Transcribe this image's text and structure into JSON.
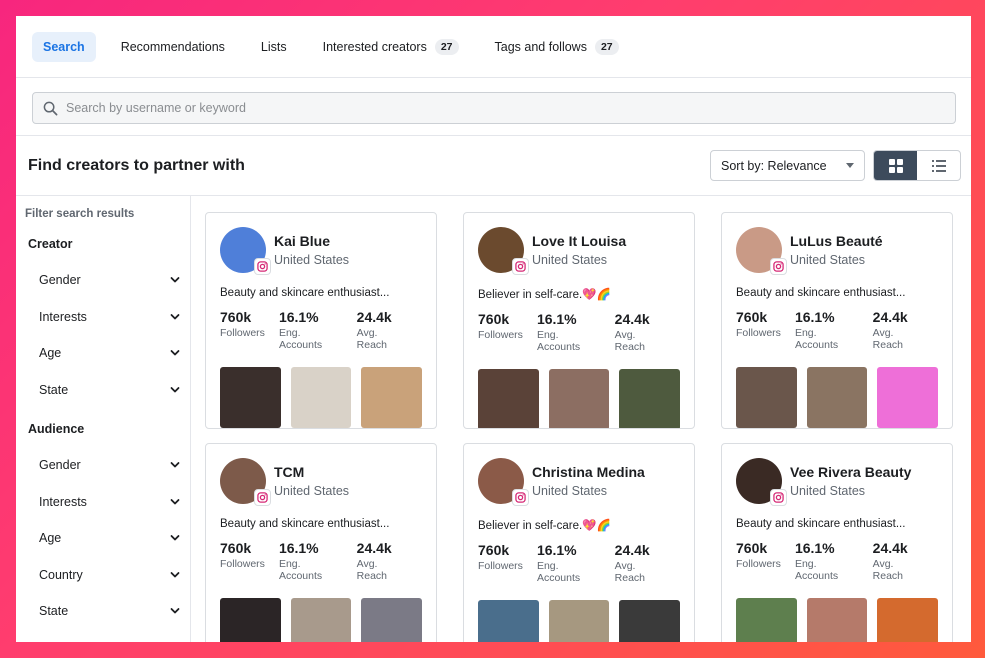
{
  "tabs": [
    {
      "label": "Search",
      "active": true
    },
    {
      "label": "Recommendations"
    },
    {
      "label": "Lists"
    },
    {
      "label": "Interested creators",
      "count": "27"
    },
    {
      "label": "Tags and follows",
      "count": "27"
    }
  ],
  "search": {
    "placeholder": "Search by username or keyword",
    "value": ""
  },
  "header": {
    "title": "Find creators to partner with",
    "sort_label": "Sort by: Relevance"
  },
  "sidebar": {
    "title": "Filter search results",
    "creator": {
      "title": "Creator",
      "items": [
        "Gender",
        "Interests",
        "Age",
        "State"
      ]
    },
    "audience": {
      "title": "Audience",
      "items": [
        "Gender",
        "Interests",
        "Age",
        "Country",
        "State"
      ]
    }
  },
  "stat_labels": {
    "followers": "Followers",
    "eng": "Eng. Accounts",
    "reach": "Avg. Reach"
  },
  "creators": [
    {
      "name": "Kai Blue",
      "location": "United States",
      "bio": "Beauty and skincare enthusiast...",
      "followers": "760k",
      "eng": "16.1%",
      "reach": "24.4k",
      "avatar_color": "#4f7fd9",
      "thumbs": [
        "#3a2f2c",
        "#d9d2c8",
        "#c9a27a"
      ]
    },
    {
      "name": "Love It Louisa",
      "location": "United States",
      "bio": "Believer in self-care.💖🌈",
      "followers": "760k",
      "eng": "16.1%",
      "reach": "24.4k",
      "avatar_color": "#6b4a2e",
      "thumbs": [
        "#5a4238",
        "#8c6e62",
        "#4e5a3e"
      ]
    },
    {
      "name": "LuLus Beauté",
      "location": "United States",
      "bio": "Beauty and skincare enthusiast...",
      "followers": "760k",
      "eng": "16.1%",
      "reach": "24.4k",
      "avatar_color": "#c99a86",
      "thumbs": [
        "#6a564b",
        "#8a7462",
        "#ee6fd8"
      ]
    },
    {
      "name": "TCM",
      "location": "United States",
      "bio": "Beauty and skincare enthusiast...",
      "followers": "760k",
      "eng": "16.1%",
      "reach": "24.4k",
      "avatar_color": "#7d5a4a",
      "thumbs": [
        "#2b2526",
        "#a89a8c",
        "#7b7a86"
      ]
    },
    {
      "name": "Christina Medina",
      "location": "United States",
      "bio": "Believer in self-care.💖🌈",
      "followers": "760k",
      "eng": "16.1%",
      "reach": "24.4k",
      "avatar_color": "#8b5a48",
      "thumbs": [
        "#4a6e8c",
        "#a69880",
        "#3a3a3a"
      ]
    },
    {
      "name": "Vee Rivera Beauty",
      "location": "United States",
      "bio": "Beauty and skincare enthusiast...",
      "followers": "760k",
      "eng": "16.1%",
      "reach": "24.4k",
      "avatar_color": "#3a2a24",
      "thumbs": [
        "#5e7f4e",
        "#b57a6a",
        "#d46a2e"
      ]
    }
  ],
  "colors": {
    "accent": "#1b74e4",
    "active_tab_bg": "#e7f0fb",
    "toggle_active": "#3d4b5c"
  }
}
